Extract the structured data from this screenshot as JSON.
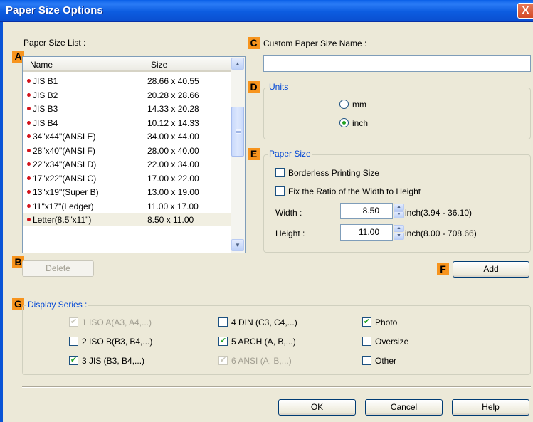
{
  "window": {
    "title": "Paper Size Options",
    "close_glyph": "X"
  },
  "markers": {
    "a": "A",
    "b": "B",
    "c": "C",
    "d": "D",
    "e": "E",
    "f": "F",
    "g": "G"
  },
  "paper_list": {
    "label": "Paper Size List :",
    "col_name": "Name",
    "col_size": "Size",
    "rows": [
      {
        "name": "JIS B1",
        "size": "28.66 x 40.55"
      },
      {
        "name": "JIS B2",
        "size": "20.28 x 28.66"
      },
      {
        "name": "JIS B3",
        "size": "14.33 x 20.28"
      },
      {
        "name": "JIS B4",
        "size": "10.12 x 14.33"
      },
      {
        "name": "34\"x44\"(ANSI E)",
        "size": "34.00 x 44.00"
      },
      {
        "name": "28\"x40\"(ANSI F)",
        "size": "28.00 x 40.00"
      },
      {
        "name": "22\"x34\"(ANSI D)",
        "size": "22.00 x 34.00"
      },
      {
        "name": "17\"x22\"(ANSI C)",
        "size": "17.00 x 22.00"
      },
      {
        "name": "13\"x19\"(Super B)",
        "size": "13.00 x 19.00"
      },
      {
        "name": "11\"x17\"(Ledger)",
        "size": "11.00 x 17.00"
      },
      {
        "name": "Letter(8.5\"x11\")",
        "size": "8.50 x 11.00"
      }
    ],
    "selected_index": 10
  },
  "buttons": {
    "delete": "Delete",
    "add": "Add",
    "ok": "OK",
    "cancel": "Cancel",
    "help": "Help"
  },
  "custom_name": {
    "label": "Custom Paper Size Name :",
    "value": ""
  },
  "units": {
    "legend": "Units",
    "mm": "mm",
    "inch": "inch",
    "selected": "inch"
  },
  "paper_size": {
    "legend": "Paper Size",
    "borderless": {
      "label": "Borderless Printing Size",
      "checked": false
    },
    "fix_ratio": {
      "label": "Fix the Ratio of the Width to Height",
      "checked": false
    },
    "width": {
      "label": "Width :",
      "value": "8.50",
      "range": "inch(3.94 - 36.10)"
    },
    "height": {
      "label": "Height :",
      "value": "11.00",
      "range": "inch(8.00 - 708.66)"
    }
  },
  "display_series": {
    "legend": "Display Series :",
    "items": [
      {
        "label": "1 ISO A(A3, A4,...)",
        "checked": true,
        "disabled": true
      },
      {
        "label": "2 ISO B(B3, B4,...)",
        "checked": false,
        "disabled": false
      },
      {
        "label": "3 JIS (B3, B4,...)",
        "checked": true,
        "disabled": false
      },
      {
        "label": "4 DIN (C3, C4,...)",
        "checked": false,
        "disabled": false
      },
      {
        "label": "5 ARCH (A, B,...)",
        "checked": true,
        "disabled": false
      },
      {
        "label": "6 ANSI (A, B,...)",
        "checked": true,
        "disabled": true
      },
      {
        "label": "Photo",
        "checked": true,
        "disabled": false
      },
      {
        "label": "Oversize",
        "checked": false,
        "disabled": false
      },
      {
        "label": "Other",
        "checked": false,
        "disabled": false
      }
    ]
  },
  "colors": {
    "title_bar": "#0a5fe8",
    "marker": "#f7941d",
    "accent_label": "#0046d5",
    "check": "#21a121"
  },
  "icons": {
    "scroll_up": "▲",
    "scroll_down": "▼",
    "check": "✔",
    "close": "close-icon"
  }
}
